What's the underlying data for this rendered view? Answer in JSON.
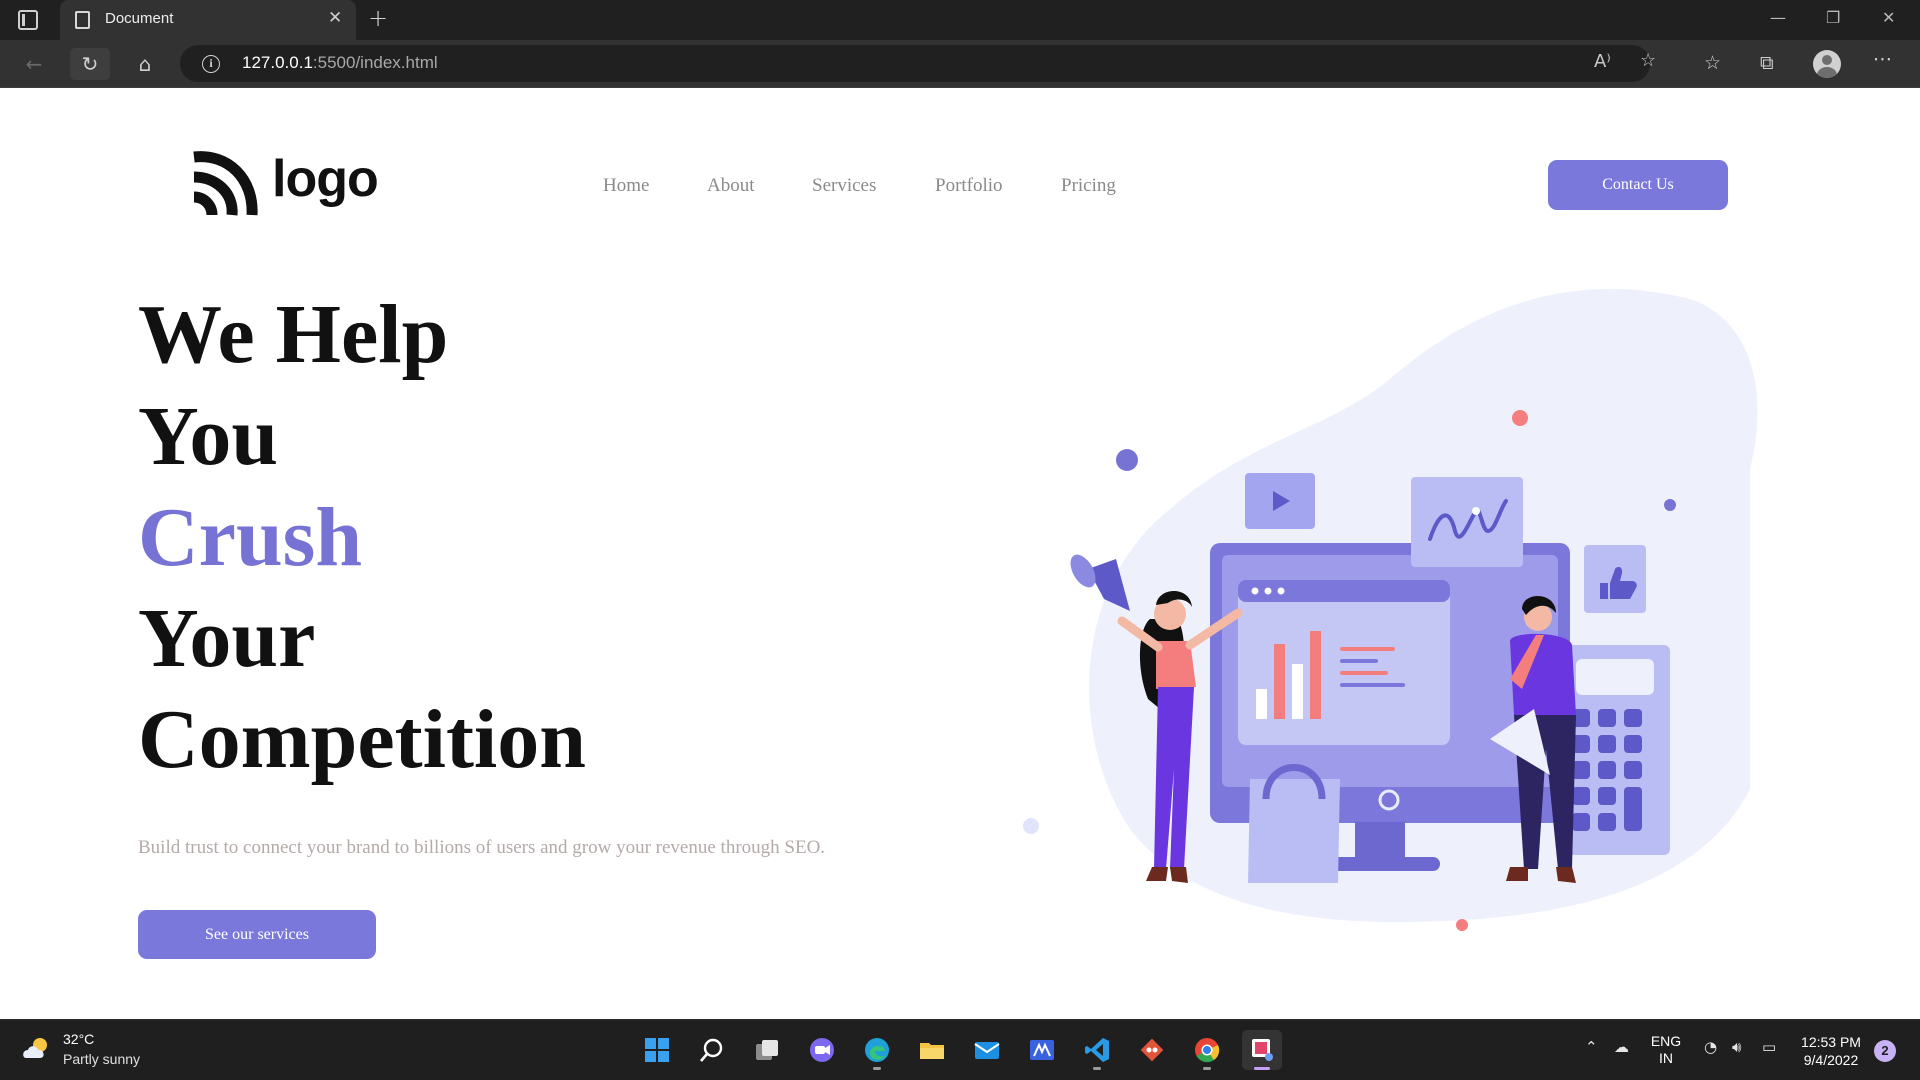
{
  "browser": {
    "tab_title": "Document",
    "url_host": "127.0.0.1",
    "url_path": ":5500/index.html"
  },
  "site": {
    "logo_text": "logo",
    "nav": [
      {
        "label": "Home"
      },
      {
        "label": "About"
      },
      {
        "label": "Services"
      },
      {
        "label": "Portfolio"
      },
      {
        "label": "Pricing"
      }
    ],
    "cta_label": "Contact Us",
    "hero": {
      "line1": "We Help",
      "line2": "You",
      "line3": "Crush",
      "line4": "Your",
      "line5": "Competition",
      "subtitle": "Build trust to connect your brand to billions of users and grow your revenue through SEO.",
      "button_label": "See our services"
    },
    "colors": {
      "accent": "#7B78DC",
      "heading": "#111111",
      "muted": "#B4AAA8"
    }
  },
  "taskbar": {
    "weather_temp": "32°C",
    "weather_desc": "Partly sunny",
    "language_line1": "ENG",
    "language_line2": "IN",
    "time": "12:53 PM",
    "date": "9/4/2022",
    "notification_count": "2",
    "apps": [
      {
        "icon": "windows-start-icon"
      },
      {
        "icon": "search-icon"
      },
      {
        "icon": "task-view-icon"
      },
      {
        "icon": "teams-chat-icon"
      },
      {
        "icon": "edge-icon"
      },
      {
        "icon": "file-explorer-icon"
      },
      {
        "icon": "mail-icon"
      },
      {
        "icon": "zoomit-icon"
      },
      {
        "icon": "vscode-icon"
      },
      {
        "icon": "git-icon"
      },
      {
        "icon": "chrome-icon"
      },
      {
        "icon": "snipping-tool-icon"
      }
    ]
  }
}
